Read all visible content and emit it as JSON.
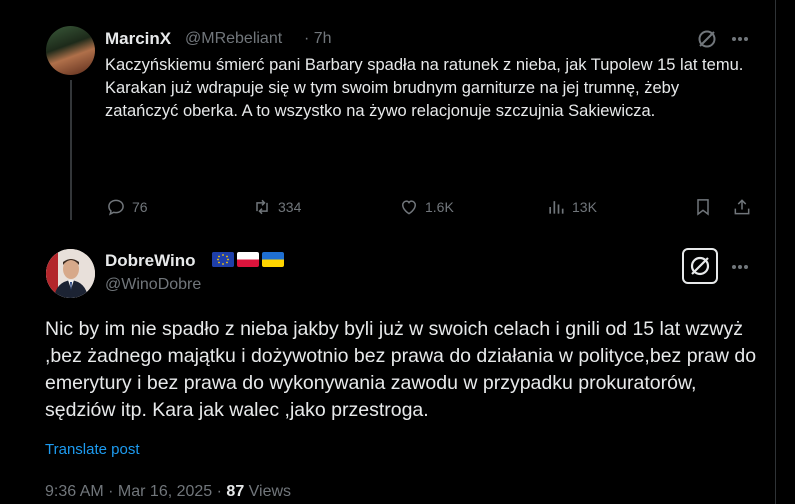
{
  "tweet1": {
    "name": "MarcinX",
    "handle": "@MRebeliant",
    "time": "· 7h",
    "lines": [
      "Kaczyńskiemu śmierć pani Barbary spadła na ratunek z nieba, jak Tupolew 15 lat temu.",
      "Karakan już wdrapuje się w tym swoim brudnym garniturze na jej trumnę, żeby zatańczyć oberka. A to wszystko na żywo relacjonuje szczujnia Sakiewicza."
    ],
    "replies": "76",
    "reposts": "334",
    "likes": "1.6K",
    "views": "13K"
  },
  "tweet2": {
    "name": "DobreWino",
    "handle": "@WinoDobre",
    "text": "Nic by im nie spadło z nieba jakby byli już w swoich celach i gnili od 15 lat wzwyż ,bez żadnego majątku i dożywotnio bez prawa do działania w polityce,bez praw do emerytury i bez prawa do wykonywania zawodu w przypadku prokuratorów, sędziów itp. Kara jak walec ,jako przestroga.",
    "translate": "Translate post",
    "time": "9:36 AM · Mar 16, 2025 · ",
    "views_count": "87",
    "views_label": " Views"
  },
  "colors": {
    "accent": "#1d9bf0",
    "muted": "#71767b",
    "text": "#e7e9ea",
    "bg": "#000000"
  },
  "icons": [
    "grok-icon",
    "more-icon",
    "reply-icon",
    "repost-icon",
    "like-icon",
    "views-icon",
    "bookmark-icon",
    "share-icon",
    "eu-flag",
    "poland-flag",
    "ukraine-flag"
  ]
}
